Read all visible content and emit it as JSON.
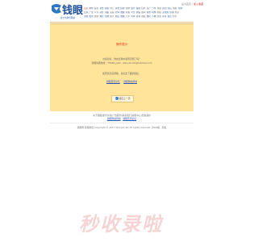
{
  "header": {
    "logo_text": "钱眼",
    "logo_domain": "qianyan.biz",
    "logo_slogan": "最全的财经网站"
  },
  "top_links": {
    "set_home": "设为首页",
    "separator": "|",
    "add_favorite": "加入收藏"
  },
  "nav_rows": [
    [
      "首页",
      "财经",
      "股票",
      "基金",
      "期货",
      "外汇",
      "黄金",
      "债券",
      "理财",
      "银行",
      "保险",
      "信托",
      "房产",
      "汽车",
      "科技",
      "新闻",
      "论坛",
      "博客",
      "专题"
    ],
    [
      "宏观",
      "产业",
      "公司",
      "商业",
      "港股",
      "美股",
      "行情",
      "数据",
      "研报",
      "公告",
      "新股",
      "板块",
      "资金",
      "机构",
      "期权",
      "贵金属",
      "原油",
      "外盘"
    ],
    [
      "消费",
      "旅游",
      "健康",
      "教育",
      "招聘",
      "留学",
      "移民",
      "收藏",
      "艺术",
      "时尚",
      "读书",
      "视频",
      "图片",
      "人物",
      "访谈",
      "评论",
      "观点",
      "排行"
    ]
  ],
  "error_box": {
    "title": "操作提示",
    "lines": [
      "访客您好，你在使用中遇到问题了吗？",
      "钱眼客服热线：75568_paid · qianyan.biz@hotmail.com",
      "如果您急需帮助，请点击下面的链接："
    ],
    "links": [
      "钱眼首页论坛",
      "钱眼网站导航"
    ],
    "back_button": "返回上一页"
  },
  "footer": {
    "links_row": [
      "关于钱眼",
      "服务条款",
      "广告服务",
      "联系我们",
      "客服中心",
      "隐私保护"
    ],
    "row2_a": "钱眼网站导航",
    "row2_b": "钱眼首页论坛",
    "copyright": "钱眼网 钱眼财经 Copyright © 2017 Qianyan.biz All rights reserved. 沪ICP备 · 隐私"
  },
  "watermark_text": "秒收录啦"
}
